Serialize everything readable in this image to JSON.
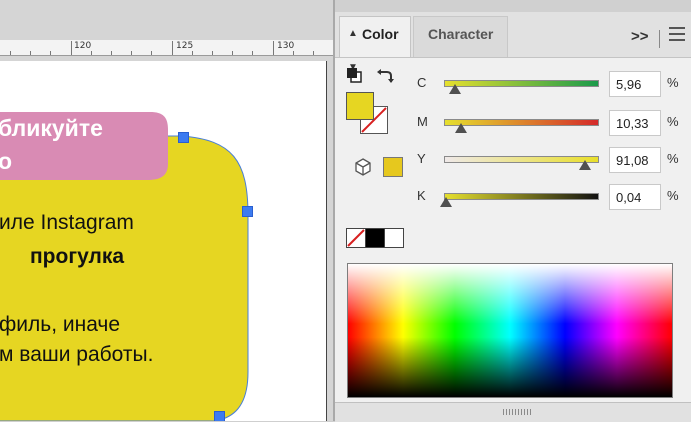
{
  "document": {
    "ruler": {
      "labels": [
        "120",
        "125",
        "130"
      ]
    },
    "pink_box_lines": [
      "бликуйте",
      "о"
    ],
    "body_lines": [
      "иле Instagram",
      "прогулка",
      "филь, иначе",
      "м ваши работы."
    ],
    "colors": {
      "fill": "#e6d622",
      "pink": "#d98bb4",
      "handle": "#3c7bf0"
    }
  },
  "panel": {
    "tabs": [
      {
        "label": "Color",
        "active": true
      },
      {
        "label": "Character",
        "active": false
      }
    ],
    "overflow_label": ">>",
    "fill_swatch_color": "#e6d622",
    "sliders": [
      {
        "label": "C",
        "value": "5,96",
        "fraction": 0.06,
        "gradient": [
          "#e6e02e",
          "#1a9a4a"
        ]
      },
      {
        "label": "M",
        "value": "10,33",
        "fraction": 0.1,
        "gradient": [
          "#e6e02e",
          "#d42a2a"
        ]
      },
      {
        "label": "Y",
        "value": "91,08",
        "fraction": 0.91,
        "gradient": [
          "#efe9e9",
          "#e9df2a"
        ]
      },
      {
        "label": "K",
        "value": "0,04",
        "fraction": 0.0,
        "gradient": [
          "#e6e02e",
          "#111111"
        ]
      }
    ],
    "unit": "%",
    "quick_swatches": [
      "none",
      "black",
      "white"
    ]
  }
}
